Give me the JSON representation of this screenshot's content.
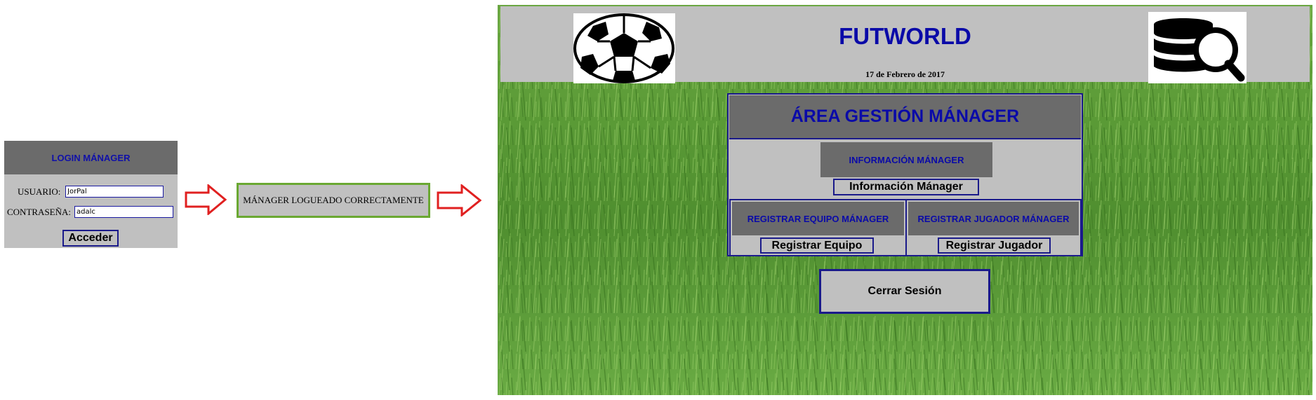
{
  "login": {
    "header": "LOGIN MÁNAGER",
    "user_label": "USUARIO:",
    "user_value": "JorPal",
    "password_label": "CONTRASEÑA:",
    "password_value": "adalc",
    "submit_label": "Acceder"
  },
  "login_success": "MÁNAGER LOGUEADO CORRECTAMENTE",
  "app": {
    "title": "FUTWORLD",
    "date": "17 de Febrero de 2017",
    "panel_title": "ÁREA GESTIÓN MÁNAGER",
    "info_header": "INFORMACIÓN MÁNAGER",
    "info_button": "Información Mánager",
    "team_header": "REGISTRAR EQUIPO MÁNAGER",
    "team_button": "Registrar Equipo",
    "player_header": "REGISTRAR JUGADOR MÁNAGER",
    "player_button": "Registrar Jugador",
    "logout_button": "Cerrar Sesión"
  },
  "colors": {
    "accent_blue": "#0a0aa8",
    "panel_gray": "#c0c0c0",
    "header_gray": "#6b6b6b",
    "arrow_red": "#e02020",
    "grass_green": "#5a9a36"
  },
  "icons": [
    "arrow-right-icon",
    "soccer-ball-icon",
    "database-search-icon"
  ]
}
